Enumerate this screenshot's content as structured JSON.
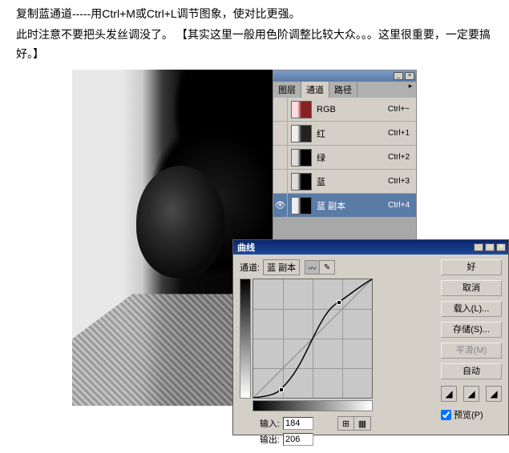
{
  "instructions": {
    "line1": "复制蓝通道-----用Ctrl+M或Ctrl+L调节图象，使对比更强。",
    "line2": "此时注意不要把头发丝调没了。 【其实这里一般用色阶调整比较大众。。。这里很重要，一定要搞好。】"
  },
  "channels_panel": {
    "tabs": {
      "layers": "图层",
      "channels": "通道",
      "paths": "路径"
    },
    "rows": [
      {
        "name": "RGB",
        "shortcut": "Ctrl+~",
        "thumb": "rgb",
        "eye": false
      },
      {
        "name": "红",
        "shortcut": "Ctrl+1",
        "thumb": "red",
        "eye": false
      },
      {
        "name": "绿",
        "shortcut": "Ctrl+2",
        "thumb": "green",
        "eye": false
      },
      {
        "name": "蓝",
        "shortcut": "Ctrl+3",
        "thumb": "blue",
        "eye": false
      },
      {
        "name": "蓝 副本",
        "shortcut": "Ctrl+4",
        "thumb": "copy",
        "eye": true,
        "selected": true
      }
    ]
  },
  "curves": {
    "title": "曲线",
    "channel_label": "通道:",
    "channel_value": "蓝 副本",
    "input_label": "输入:",
    "output_label": "输出:",
    "input_value": "184",
    "output_value": "206",
    "buttons": {
      "ok": "好",
      "cancel": "取消",
      "load": "载入(L)...",
      "save": "存储(S)...",
      "smooth": "平滑(M)",
      "auto": "自动"
    },
    "preview_label": "预览(P)"
  },
  "chart_data": {
    "type": "line",
    "title": "曲线",
    "xlabel": "输入",
    "ylabel": "输出",
    "xlim": [
      0,
      255
    ],
    "ylim": [
      0,
      255
    ],
    "points": [
      {
        "x": 0,
        "y": 0
      },
      {
        "x": 60,
        "y": 18
      },
      {
        "x": 128,
        "y": 128
      },
      {
        "x": 184,
        "y": 206
      },
      {
        "x": 255,
        "y": 255
      }
    ]
  }
}
